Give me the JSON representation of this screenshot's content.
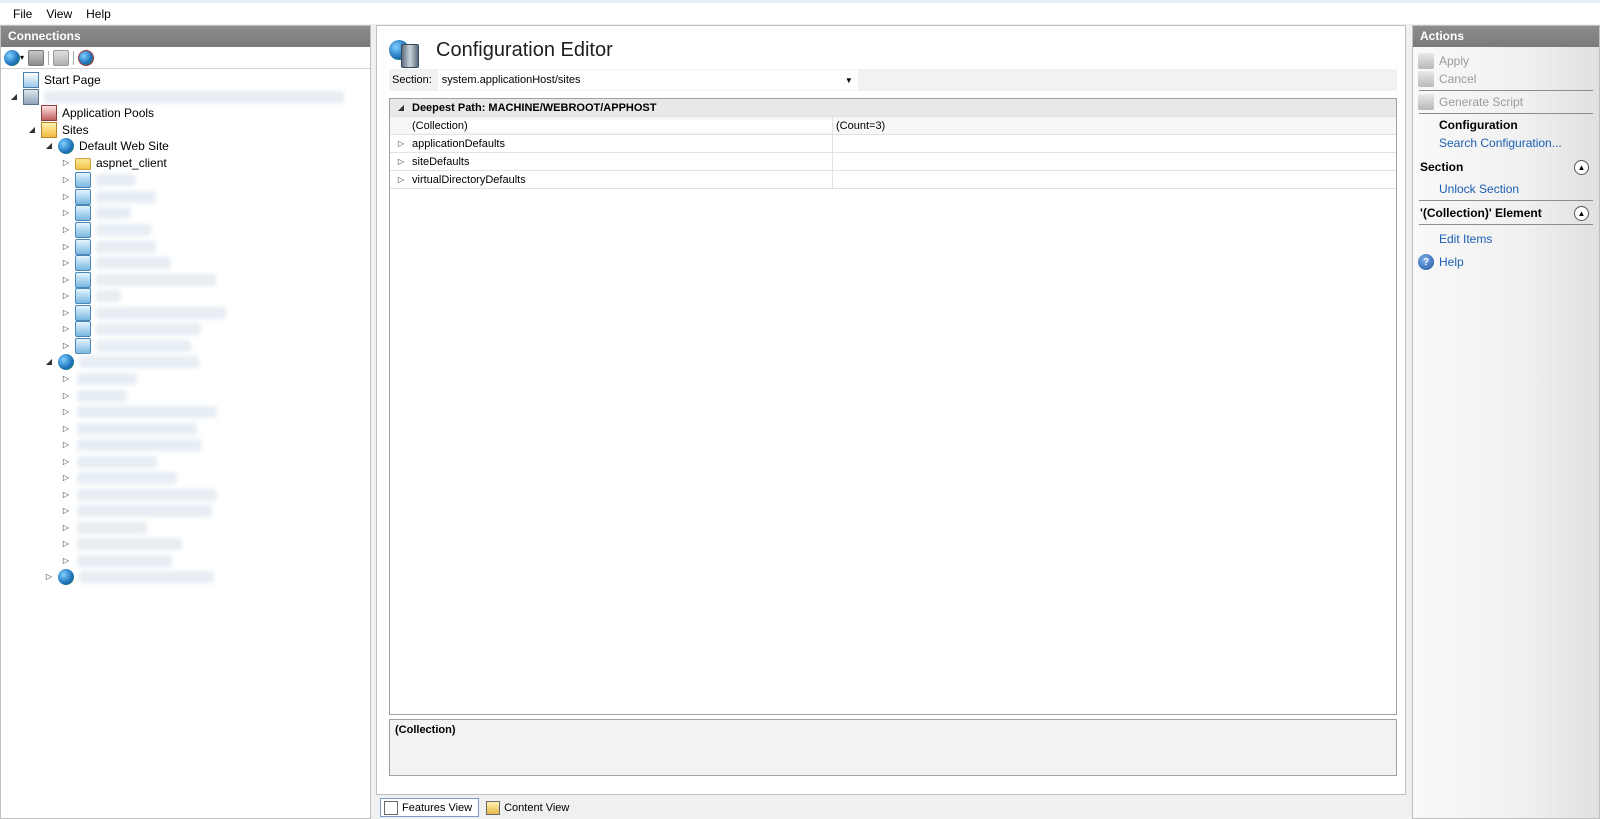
{
  "menu": {
    "file": "File",
    "view": "View",
    "help": "Help"
  },
  "connections": {
    "title": "Connections",
    "tree": {
      "start_page": "Start Page",
      "app_pools": "Application Pools",
      "sites": "Sites",
      "default_site": "Default Web Site",
      "aspnet_client": "aspnet_client"
    }
  },
  "editor": {
    "title": "Configuration Editor",
    "section_label": "Section:",
    "section_value": "system.applicationHost/sites",
    "deepest_path": "Deepest Path: MACHINE/WEBROOT/APPHOST",
    "rows": [
      {
        "name": "(Collection)",
        "value": "(Count=3)"
      },
      {
        "name": "applicationDefaults",
        "value": ""
      },
      {
        "name": "siteDefaults",
        "value": ""
      },
      {
        "name": "virtualDirectoryDefaults",
        "value": ""
      }
    ],
    "description": "(Collection)"
  },
  "view_tabs": {
    "features": "Features View",
    "content": "Content View"
  },
  "actions": {
    "title": "Actions",
    "apply": "Apply",
    "cancel": "Cancel",
    "generate_script": "Generate Script",
    "configuration": "Configuration",
    "search_configuration": "Search Configuration...",
    "section_group": "Section",
    "unlock_section": "Unlock Section",
    "element_group": "'(Collection)' Element",
    "edit_items": "Edit Items",
    "help": "Help"
  },
  "colors": {
    "link": "#1a5fb4",
    "header_bg": "#808080",
    "disabled": "#9a9a9a"
  }
}
